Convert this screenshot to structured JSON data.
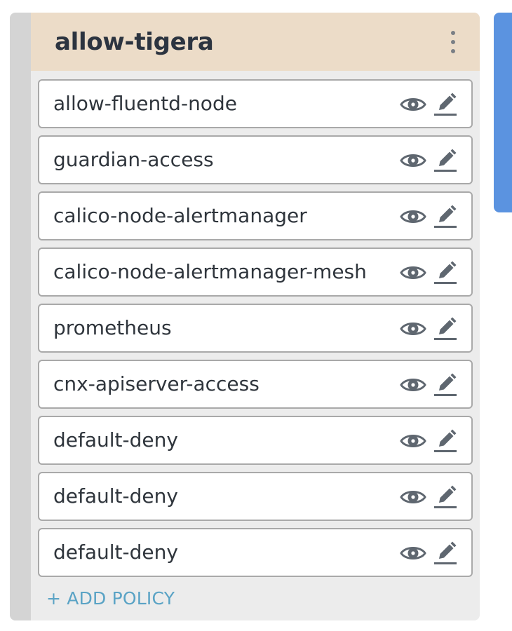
{
  "tier": {
    "title": "allow-tigera",
    "menu_icon": "kebab-menu-icon",
    "header_color": "#ecdcc8",
    "background_color": "#ececec"
  },
  "policies": [
    {
      "name": "allow-fluentd-node"
    },
    {
      "name": "guardian-access"
    },
    {
      "name": "calico-node-alertmanager"
    },
    {
      "name": "calico-node-alertmanager-mesh"
    },
    {
      "name": "prometheus"
    },
    {
      "name": "cnx-apiserver-access"
    },
    {
      "name": "default-deny"
    },
    {
      "name": "default-deny"
    },
    {
      "name": "default-deny"
    }
  ],
  "row_icons": {
    "view": "eye-icon",
    "edit": "pencil-icon",
    "color": "#5f6770"
  },
  "add_policy": {
    "label": "+ ADD POLICY",
    "color": "#5aa3c5"
  },
  "adjacent_panel_color": "#5b93e0"
}
